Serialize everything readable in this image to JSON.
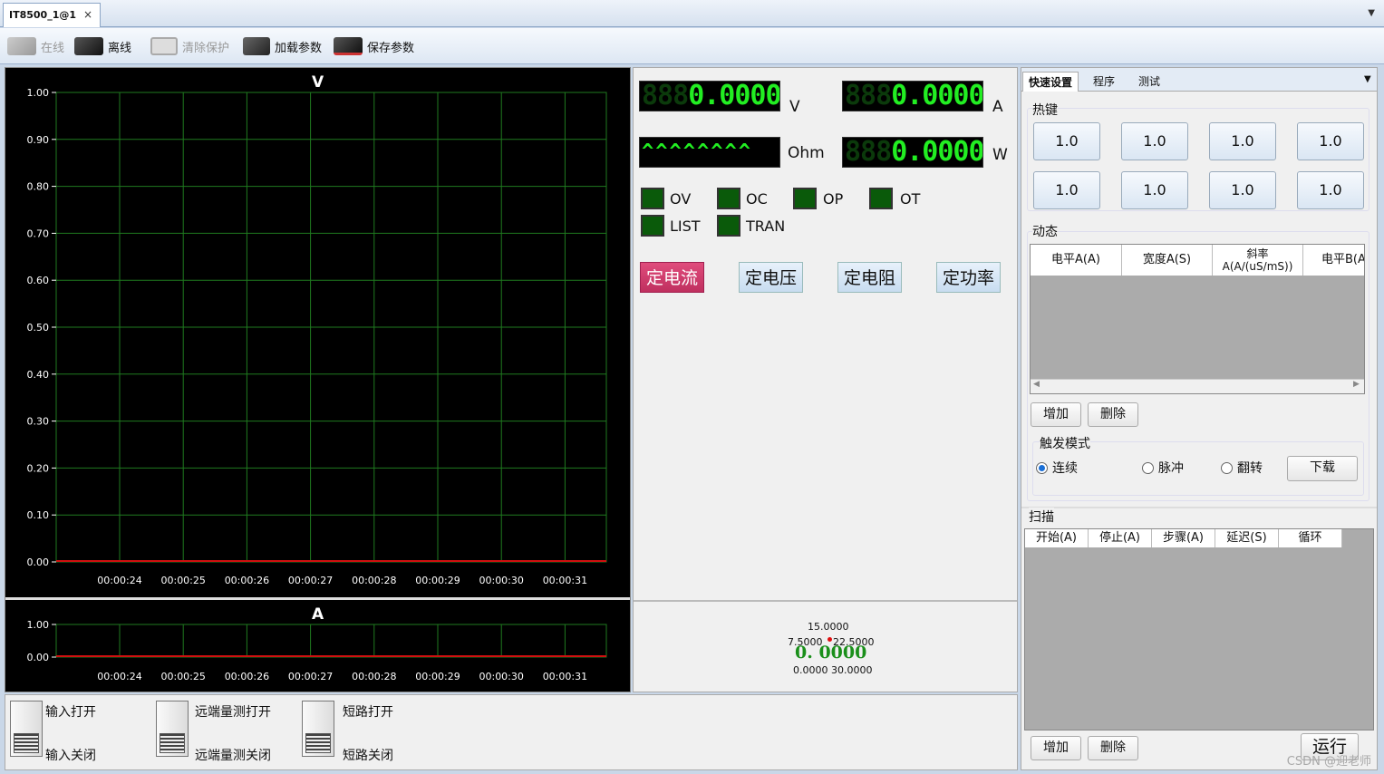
{
  "window": {
    "tab_title": "IT8500_1@1",
    "tab_close": "×",
    "dropdown": "▼"
  },
  "toolbar": {
    "online": "在线",
    "offline": "离线",
    "clear_protect": "清除保护",
    "load_params": "加载参数",
    "save_params": "保存参数"
  },
  "charts": {
    "top": {
      "title": "V",
      "y_ticks": [
        "1.00",
        "0.90",
        "0.80",
        "0.70",
        "0.60",
        "0.50",
        "0.40",
        "0.30",
        "0.20",
        "0.10",
        "0.00"
      ],
      "x_ticks": [
        "00:00:24",
        "00:00:25",
        "00:00:26",
        "00:00:27",
        "00:00:28",
        "00:00:29",
        "00:00:30",
        "00:00:31"
      ]
    },
    "bottom": {
      "title": "A",
      "y_ticks": [
        "1.00",
        "0.00"
      ],
      "x_ticks": [
        "00:00:24",
        "00:00:25",
        "00:00:26",
        "00:00:27",
        "00:00:28",
        "00:00:29",
        "00:00:30",
        "00:00:31"
      ]
    }
  },
  "meters": {
    "voltage": {
      "dim": "888",
      "value": "0.0000",
      "unit": "V"
    },
    "current": {
      "dim": "888",
      "value": "0.0000",
      "unit": "A"
    },
    "resistance": {
      "value": "^^^^^^^^",
      "unit": "Ohm"
    },
    "power": {
      "dim": "888",
      "value": "0.0000",
      "unit": "W"
    }
  },
  "indicators": [
    "OV",
    "OC",
    "OP",
    "OT",
    "LIST",
    "TRAN"
  ],
  "modes": {
    "cc": "定电流",
    "cv": "定电压",
    "cr": "定电阻",
    "cw": "定功率",
    "active": "cc"
  },
  "gauge": {
    "max": "15.0000",
    "left": "7.5000",
    "right": "22.5000",
    "value": "0. 0000",
    "bottom": "0.0000 30.0000"
  },
  "right": {
    "tabs": [
      "快速设置",
      "程序",
      "测试"
    ],
    "hotkeys_label": "热键",
    "hotkeys": [
      "1.0",
      "1.0",
      "1.0",
      "1.0",
      "1.0",
      "1.0",
      "1.0",
      "1.0"
    ],
    "dynamic_label": "动态",
    "dynamic_headers": [
      "电平A(A)",
      "宽度A(S)",
      "斜率\nA(A/(uS/mS))",
      "电平B(A"
    ],
    "add": "增加",
    "delete": "删除",
    "trigger_label": "触发模式",
    "trigger_options": [
      "连续",
      "脉冲",
      "翻转"
    ],
    "download": "下载",
    "scan_label": "扫描",
    "scan_headers": [
      "开始(A)",
      "停止(A)",
      "步骤(A)",
      "延迟(S)",
      "循环"
    ],
    "run": "运行"
  },
  "switches": {
    "input_open": "输入打开",
    "input_close": "输入关闭",
    "remote_open": "远端量测打开",
    "remote_close": "远端量测关闭",
    "short_open": "短路打开",
    "short_close": "短路关闭"
  },
  "watermark": "CSDN @迎老师",
  "colors": {
    "grid": "#1f7a1f",
    "trace": "#d01010",
    "led": "#0a5a0a",
    "active_mode": "#d0386a"
  }
}
